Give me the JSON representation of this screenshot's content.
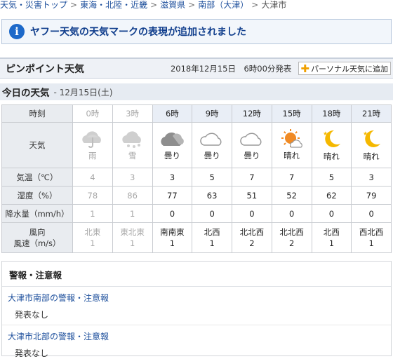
{
  "breadcrumb": {
    "items": [
      "天気・災害トップ",
      "東海・北陸・近畿",
      "滋賀県",
      "南部（大津）"
    ],
    "current": "大津市",
    "separator": ">"
  },
  "notice": {
    "text": "ヤフー天気の天気マークの表現が追加されました"
  },
  "pinpoint": {
    "title": "ピンポイント天気",
    "announced": "2018年12月15日　6時00分発表",
    "personal_button": "パーソナル天気に追加"
  },
  "today": {
    "title": "今日の天気",
    "date": "- 12月15日(土)"
  },
  "forecast": {
    "labels": {
      "hour": "時刻",
      "weather": "天気",
      "temp": "気温（℃）",
      "humidity": "湿度（%）",
      "rain": "降水量（mm/h）",
      "wind_dir": "風向",
      "wind_speed": "風速（m/s）"
    },
    "hours": [
      "0時",
      "3時",
      "6時",
      "9時",
      "12時",
      "15時",
      "18時",
      "21時"
    ],
    "weather": [
      "雨",
      "雪",
      "曇り",
      "曇り",
      "曇り",
      "晴れ",
      "晴れ",
      "晴れ"
    ],
    "icons": [
      "rain-cloud-icon",
      "snow-cloud-icon",
      "dark-cloud-icon",
      "cloud-icon",
      "cloud-icon",
      "sun-cloud-icon",
      "moon-icon",
      "moon-icon"
    ],
    "temp": [
      "4",
      "3",
      "3",
      "5",
      "7",
      "7",
      "5",
      "3"
    ],
    "humidity": [
      "78",
      "86",
      "77",
      "63",
      "51",
      "52",
      "62",
      "79"
    ],
    "rain": [
      "1",
      "1",
      "0",
      "0",
      "0",
      "0",
      "0",
      "0"
    ],
    "wind_dir": [
      "北東",
      "東北東",
      "南南東",
      "北西",
      "北北西",
      "北北西",
      "北西",
      "西北西"
    ],
    "wind_speed": [
      "1",
      "1",
      "1",
      "1",
      "2",
      "2",
      "1",
      "1"
    ],
    "past_count": 2
  },
  "alerts": {
    "title": "警報・注意報",
    "regions": [
      {
        "name": "大津市南部の警報・注意報",
        "status": "発表なし"
      },
      {
        "name": "大津市北部の警報・注意報",
        "status": "発表なし"
      }
    ]
  },
  "colors": {
    "link": "#1d4f9c",
    "header_bg": "#eef1f6",
    "sun": "#f5a623",
    "moon": "#f5b800"
  }
}
